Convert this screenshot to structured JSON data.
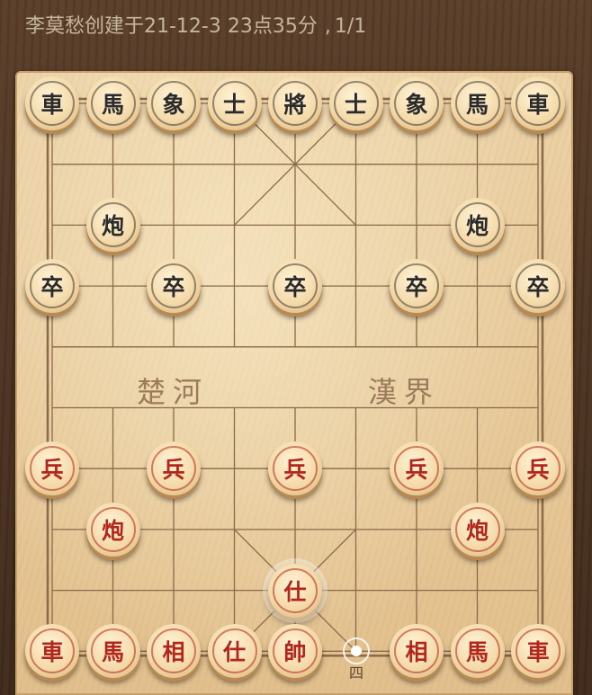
{
  "header": {
    "title": "李莫愁创建于21-12-3 23点35分",
    "separator": ",",
    "page_counter": "1/1"
  },
  "board": {
    "river_left": "楚河",
    "river_right": "漢界",
    "last_move_label": "四"
  },
  "pieces": [
    {
      "char": "車",
      "side": "black",
      "col": 0,
      "row": 0
    },
    {
      "char": "馬",
      "side": "black",
      "col": 1,
      "row": 0
    },
    {
      "char": "象",
      "side": "black",
      "col": 2,
      "row": 0
    },
    {
      "char": "士",
      "side": "black",
      "col": 3,
      "row": 0
    },
    {
      "char": "將",
      "side": "black",
      "col": 4,
      "row": 0
    },
    {
      "char": "士",
      "side": "black",
      "col": 5,
      "row": 0
    },
    {
      "char": "象",
      "side": "black",
      "col": 6,
      "row": 0
    },
    {
      "char": "馬",
      "side": "black",
      "col": 7,
      "row": 0
    },
    {
      "char": "車",
      "side": "black",
      "col": 8,
      "row": 0
    },
    {
      "char": "炮",
      "side": "black",
      "col": 1,
      "row": 2
    },
    {
      "char": "炮",
      "side": "black",
      "col": 7,
      "row": 2
    },
    {
      "char": "卒",
      "side": "black",
      "col": 0,
      "row": 3
    },
    {
      "char": "卒",
      "side": "black",
      "col": 2,
      "row": 3
    },
    {
      "char": "卒",
      "side": "black",
      "col": 4,
      "row": 3
    },
    {
      "char": "卒",
      "side": "black",
      "col": 6,
      "row": 3
    },
    {
      "char": "卒",
      "side": "black",
      "col": 8,
      "row": 3
    },
    {
      "char": "兵",
      "side": "red",
      "col": 0,
      "row": 6
    },
    {
      "char": "兵",
      "side": "red",
      "col": 2,
      "row": 6
    },
    {
      "char": "兵",
      "side": "red",
      "col": 4,
      "row": 6
    },
    {
      "char": "兵",
      "side": "red",
      "col": 6,
      "row": 6
    },
    {
      "char": "兵",
      "side": "red",
      "col": 8,
      "row": 6
    },
    {
      "char": "炮",
      "side": "red",
      "col": 1,
      "row": 7
    },
    {
      "char": "炮",
      "side": "red",
      "col": 7,
      "row": 7
    },
    {
      "char": "仕",
      "side": "red",
      "col": 4,
      "row": 8,
      "selected": true
    },
    {
      "char": "車",
      "side": "red",
      "col": 0,
      "row": 9
    },
    {
      "char": "馬",
      "side": "red",
      "col": 1,
      "row": 9
    },
    {
      "char": "相",
      "side": "red",
      "col": 2,
      "row": 9
    },
    {
      "char": "仕",
      "side": "red",
      "col": 3,
      "row": 9
    },
    {
      "char": "帥",
      "side": "red",
      "col": 4,
      "row": 9
    },
    {
      "char": "相",
      "side": "red",
      "col": 6,
      "row": 9
    },
    {
      "char": "馬",
      "side": "red",
      "col": 7,
      "row": 9
    },
    {
      "char": "車",
      "side": "red",
      "col": 8,
      "row": 9
    }
  ],
  "colors": {
    "red_piece_text": "#b3261b",
    "black_piece_text": "#2b2b2b",
    "board_line": "#8a6a48"
  }
}
